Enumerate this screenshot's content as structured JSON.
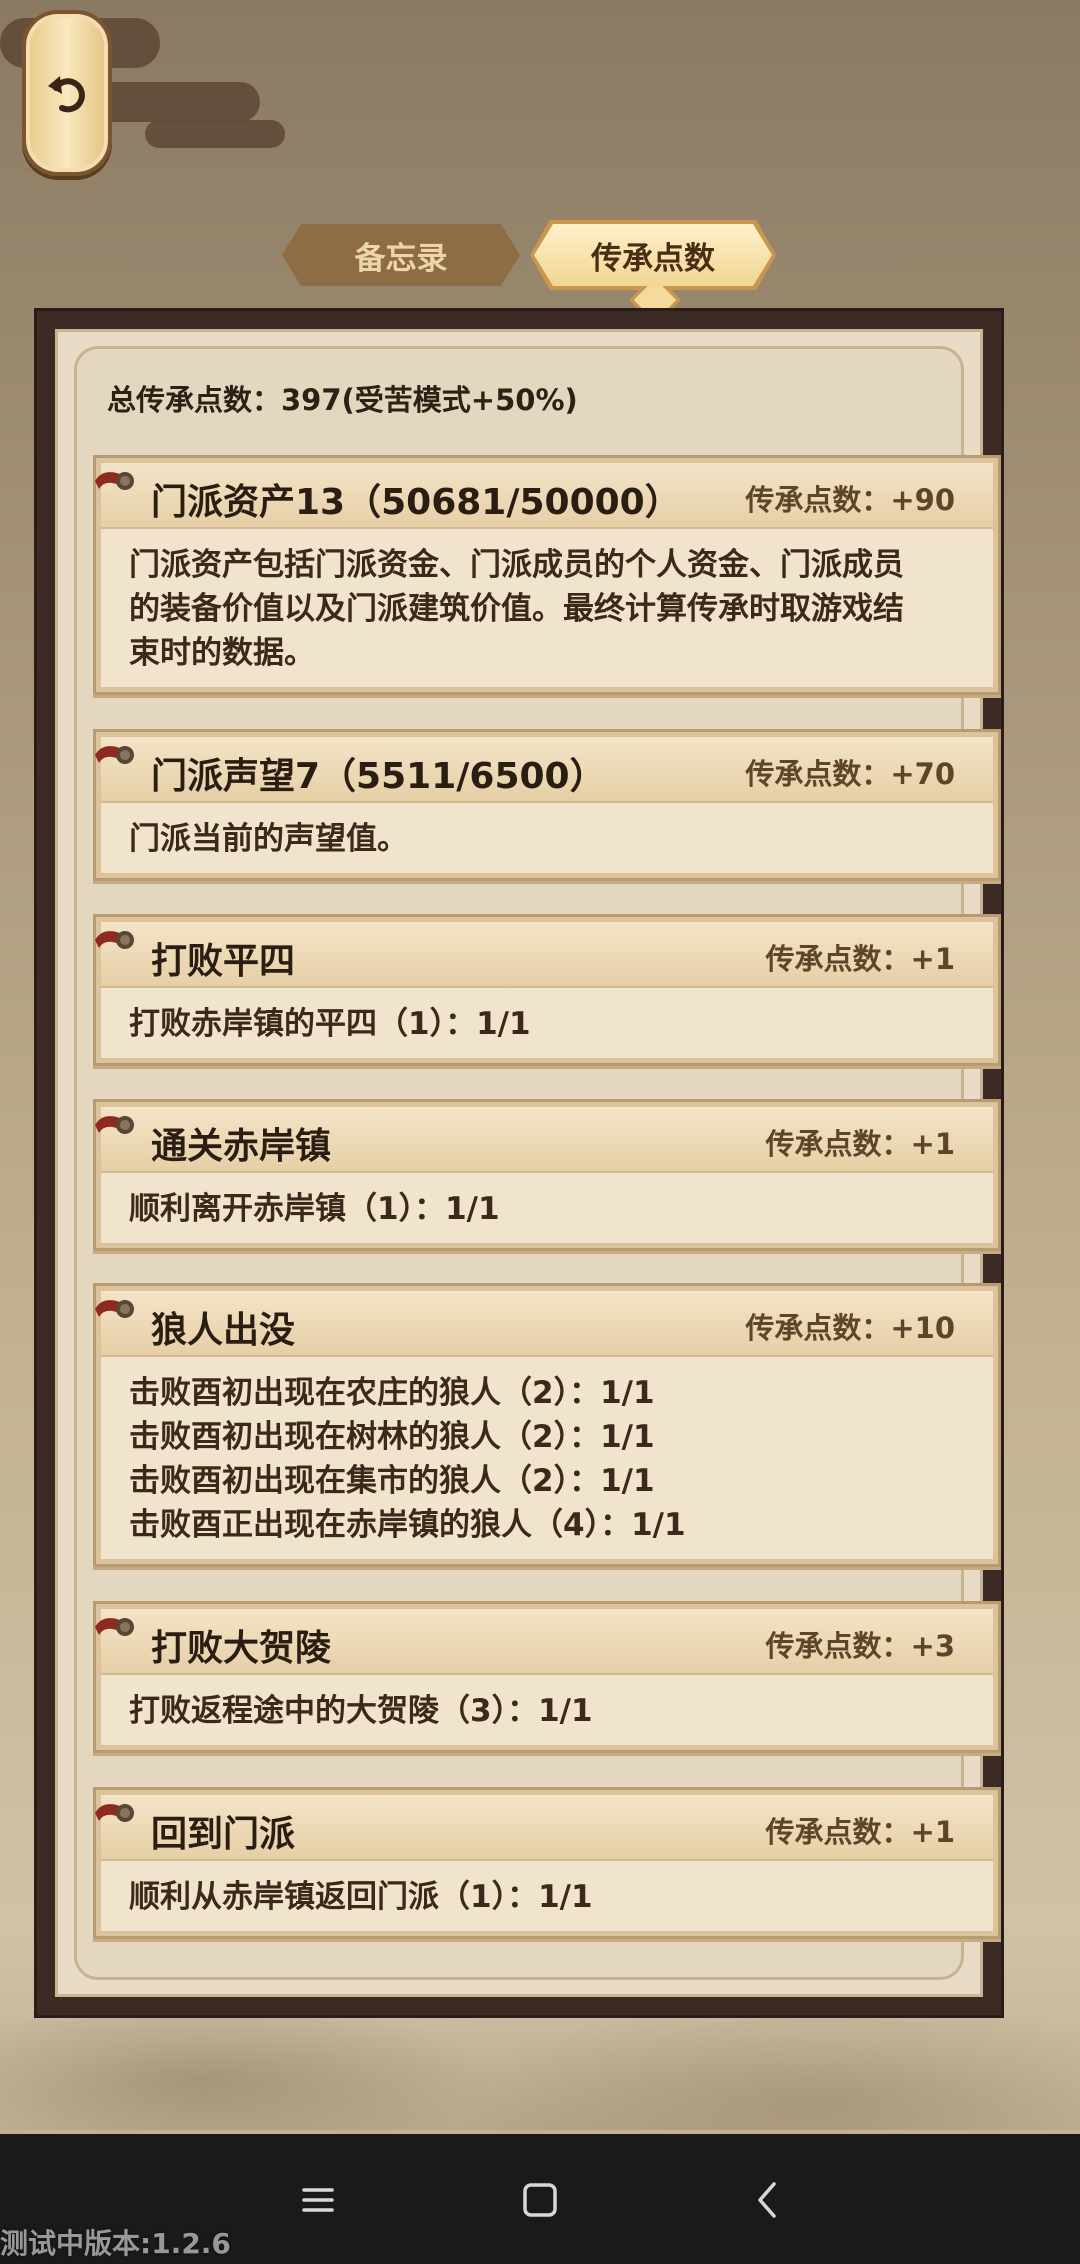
{
  "tabs": [
    {
      "label": "备忘录",
      "active": false
    },
    {
      "label": "传承点数",
      "active": true
    }
  ],
  "total": "总传承点数：397(受苦模式+50%)",
  "entries": [
    {
      "title": "门派资产13（50681/50000）",
      "points": "传承点数：+90",
      "lines": [
        "门派资产包括门派资金、门派成员的个人资金、门派成员",
        "的装备价值以及门派建筑价值。最终计算传承时取游戏结",
        "束时的数据。"
      ]
    },
    {
      "title": "门派声望7（5511/6500）",
      "points": "传承点数：+70",
      "lines": [
        "门派当前的声望值。"
      ]
    },
    {
      "title": "打败平四",
      "points": "传承点数：+1",
      "lines": [
        "打败赤岸镇的平四（1）：1/1"
      ]
    },
    {
      "title": "通关赤岸镇",
      "points": "传承点数：+1",
      "lines": [
        "顺利离开赤岸镇（1）：1/1"
      ]
    },
    {
      "title": "狼人出没",
      "points": "传承点数：+10",
      "lines": [
        "击败酉初出现在农庄的狼人（2）：1/1",
        "击败酉初出现在树林的狼人（2）：1/1",
        "击败酉初出现在集市的狼人（2）：1/1",
        "击败酉正出现在赤岸镇的狼人（4）：1/1"
      ]
    },
    {
      "title": "打败大贺陵",
      "points": "传承点数：+3",
      "lines": [
        "打败返程途中的大贺陵（3）：1/1"
      ]
    },
    {
      "title": "回到门派",
      "points": "传承点数：+1",
      "lines": [
        "顺利从赤岸镇返回门派（1）：1/1"
      ]
    }
  ],
  "version": "测试中版本:1.2.6",
  "icons": {
    "back": "back-arrow-icon",
    "menu": "menu-icon",
    "home": "home-square-icon",
    "nav_back": "chevron-left-icon"
  },
  "colors": {
    "frame": "#3c2a24",
    "panel": "#e4d7bf",
    "accent": "#f1d694"
  }
}
